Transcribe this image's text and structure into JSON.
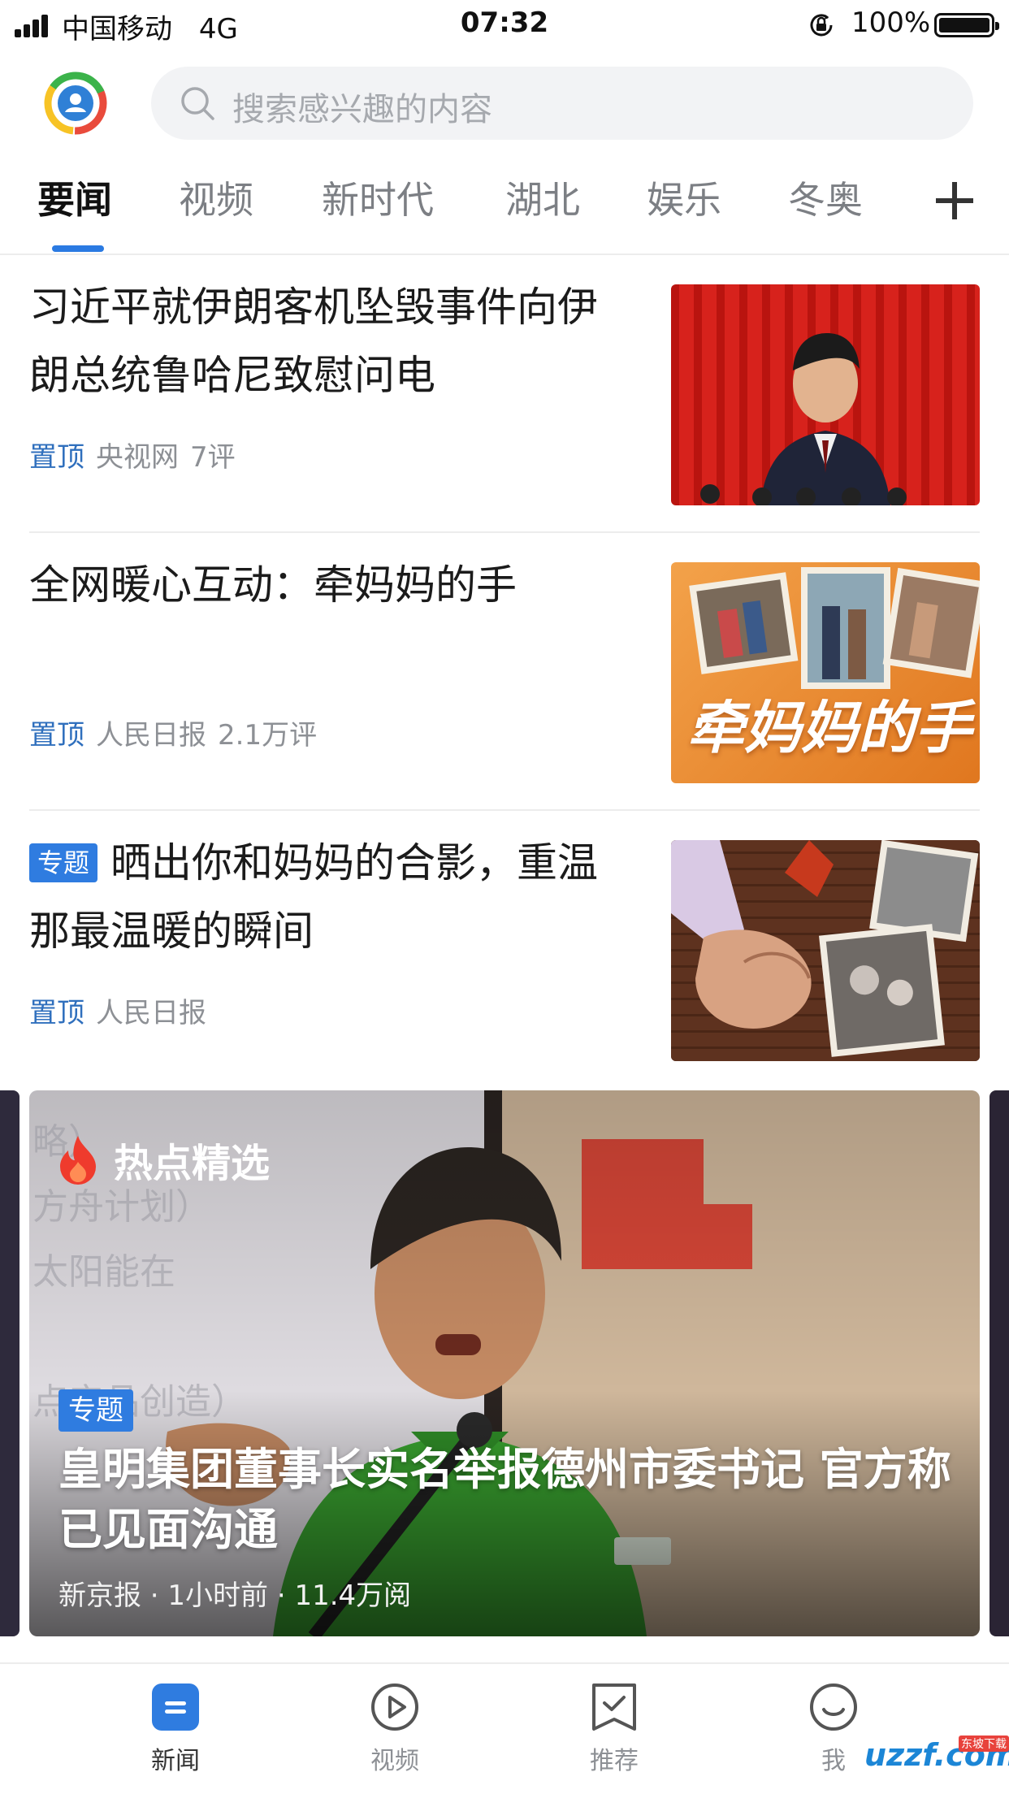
{
  "status_bar": {
    "carrier": "中国移动",
    "network": "4G",
    "time": "07:32",
    "battery": "100%"
  },
  "search": {
    "placeholder": "搜索感兴趣的内容"
  },
  "tabs": [
    {
      "label": "要闻"
    },
    {
      "label": "视频"
    },
    {
      "label": "新时代"
    },
    {
      "label": "湖北"
    },
    {
      "label": "娱乐"
    },
    {
      "label": "冬奥"
    }
  ],
  "articles": [
    {
      "title": "习近平就伊朗客机坠毁事件向伊朗总统鲁哈尼致慰问电",
      "pin": "置顶",
      "source": "央视网",
      "comments": "7评"
    },
    {
      "title": "全网暖心互动：牵妈妈的手",
      "pin": "置顶",
      "source": "人民日报",
      "comments": "2.1万评",
      "thumb_text": "牵妈妈的手"
    },
    {
      "badge": "专题",
      "title": "晒出你和妈妈的合影，重温那最温暖的瞬间",
      "pin": "置顶",
      "source": "人民日报"
    }
  ],
  "hot": {
    "label": "热点精选",
    "badge": "专题",
    "title": "皇明集团董事长实名举报德州市委书记 官方称已见面沟通",
    "meta": "新京报 · 1小时前 · 11.4万阅",
    "bg_text": [
      "略）",
      "方舟计划）",
      "太阳能在",
      "点产品创造）"
    ]
  },
  "nav": [
    {
      "label": "新闻"
    },
    {
      "label": "视频"
    },
    {
      "label": "推荐"
    },
    {
      "label": "我"
    }
  ],
  "watermark": {
    "text": "uzzf.com",
    "sub": "东坡下载"
  },
  "colors": {
    "accent": "#2a7ae2",
    "pin_text": "#2f6fbd",
    "badge": "#2f7ce0"
  }
}
